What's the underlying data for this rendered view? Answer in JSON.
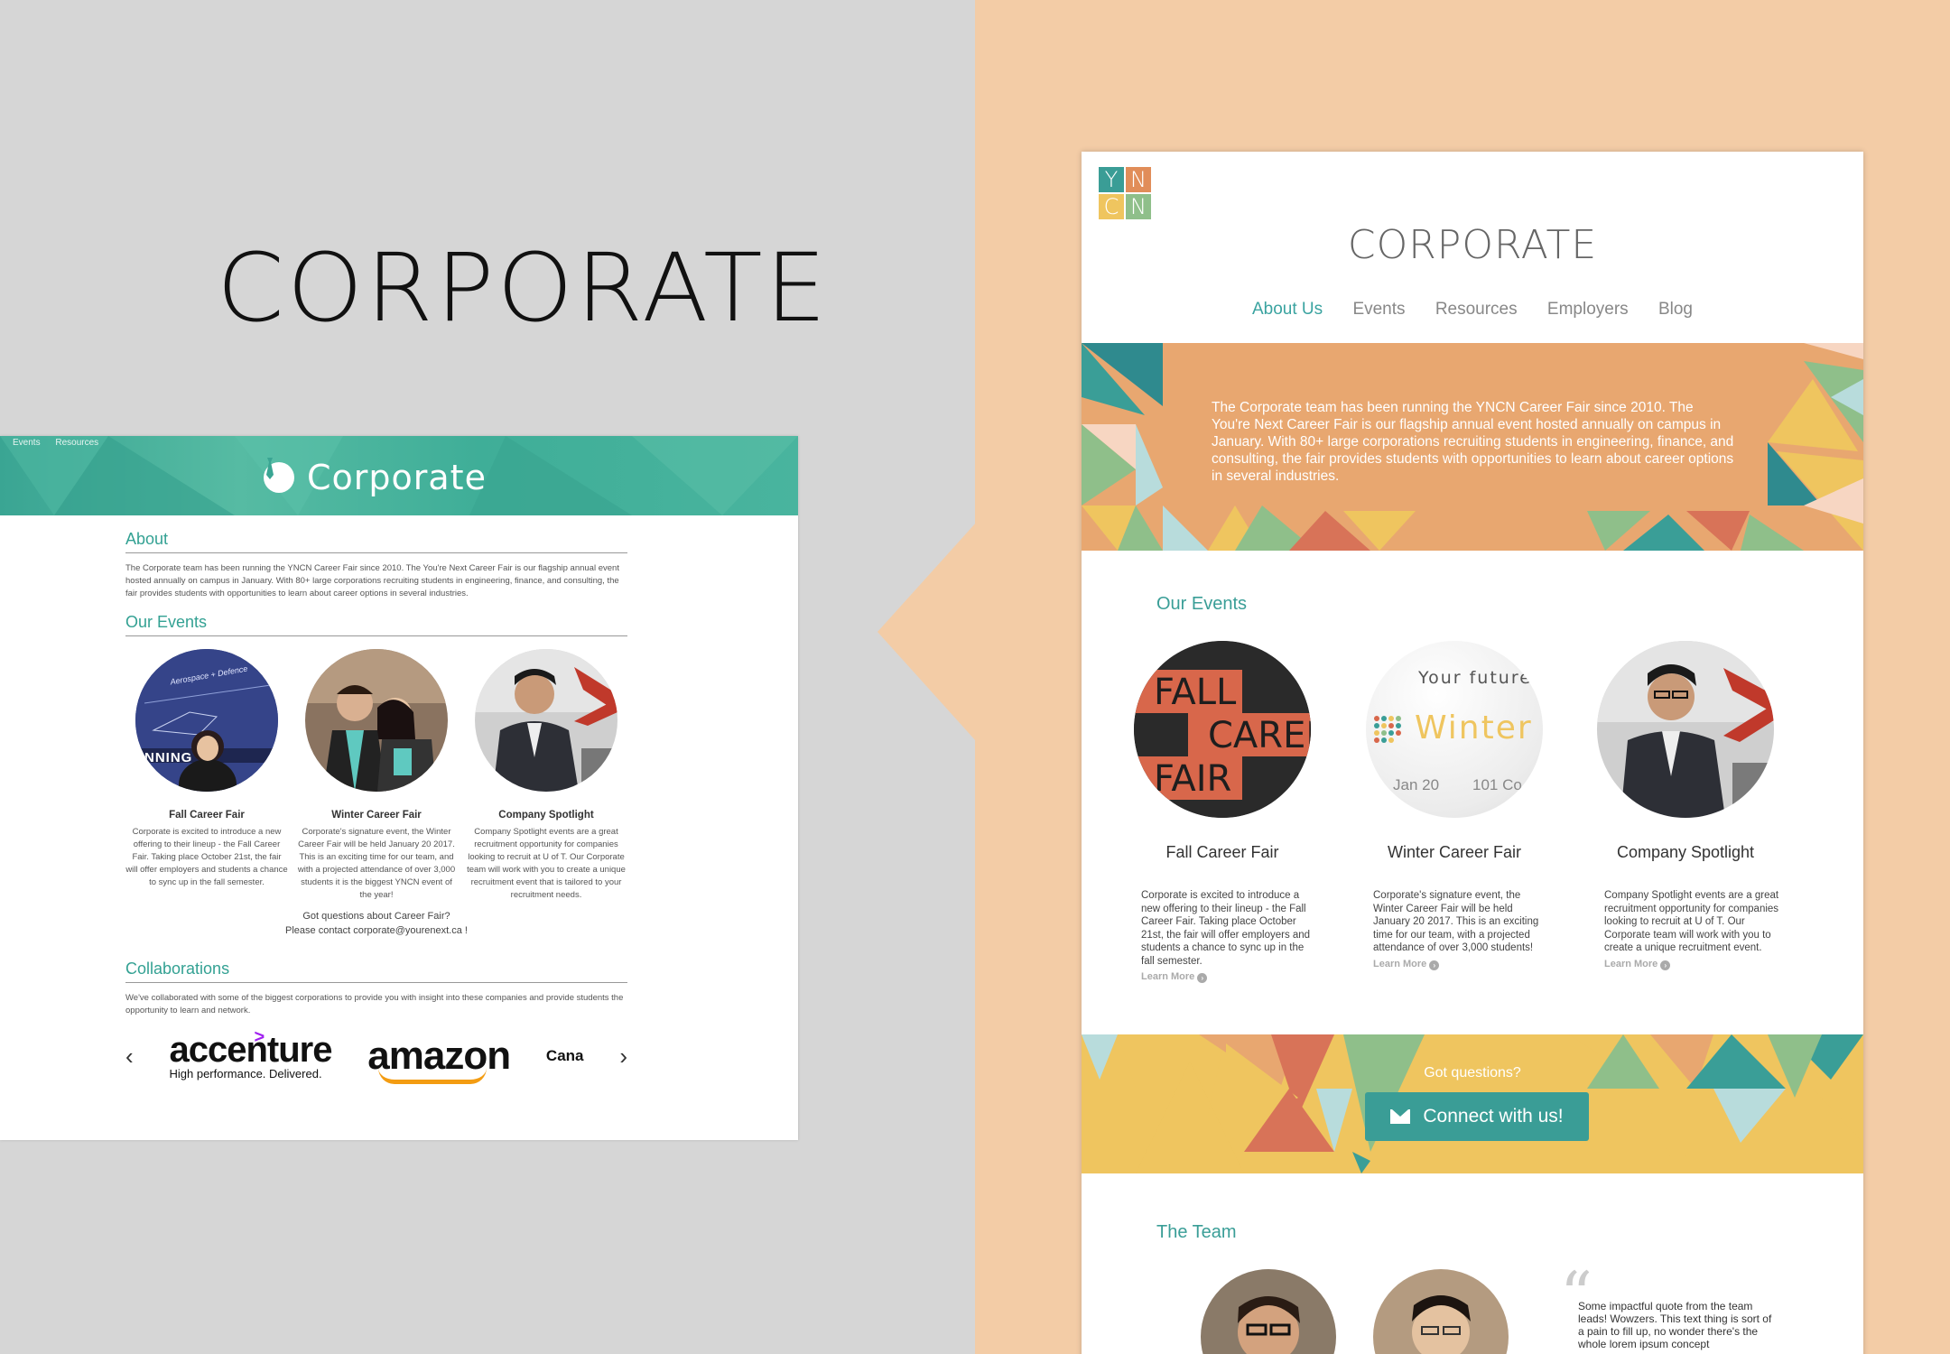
{
  "page_title": "CORPORATE",
  "colors": {
    "teal": "#3aa3a0",
    "orange": "#e8a770",
    "yellow": "#efc55f",
    "peach_bg": "#f3cca6",
    "grey_bg": "#d6d6d6"
  },
  "old_site": {
    "nav": [
      "Events",
      "Resources"
    ],
    "banner_title": "Corporate",
    "about_heading": "About",
    "about_text": "The Corporate team has been running the YNCN Career Fair since 2010. The You're Next Career Fair is our flagship annual event hosted annually on campus in January. With 80+ large corporations recruiting students in engineering, finance, and consulting, the fair provides students with opportunities to learn about career options in several industries.",
    "events_heading": "Our Events",
    "events": [
      {
        "title": "Fall Career Fair",
        "desc": "Corporate is excited to introduce a new offering to their lineup - the Fall Career Fair. Taking place October 21st, the fair will offer employers and students a chance to sync up in the fall semester."
      },
      {
        "title": "Winter Career Fair",
        "desc": "Corporate's signature event, the Winter Career Fair will be held January 20 2017. This is an exciting time for our team, and with a projected attendance of over 3,000 students it is the biggest YNCN event of the year!"
      },
      {
        "title": "Company Spotlight",
        "desc": "Company Spotlight events are a great recruitment opportunity for companies looking to recruit at U of T. Our Corporate team will work with you to create a unique recruitment event that is tailored to your recruitment needs."
      }
    ],
    "question_line1": "Got questions about Career Fair?",
    "question_line2": "Please contact corporate@yourenext.ca !",
    "collab_heading": "Collaborations",
    "collab_text": "We've collaborated with some of the biggest corporations to provide you with insight into these companies and provide students the opportunity to learn and network.",
    "logos": {
      "accenture": "accenture",
      "accenture_tag": "High performance. Delivered.",
      "amazon": "amazon",
      "partial": "Cana"
    },
    "arrow_left": "‹",
    "arrow_right": "›",
    "photo_sign_1": "Aerospace + Defence",
    "photo_sign_2": "NNING"
  },
  "new_site": {
    "logo_letters": [
      "Y",
      "N",
      "C",
      "N"
    ],
    "title": "CORPORATE",
    "nav": [
      "About Us",
      "Events",
      "Resources",
      "Employers",
      "Blog"
    ],
    "hero_text": "The Corporate team has been running the YNCN Career Fair since 2010. The You're Next Career Fair is our flagship annual event hosted annually on campus in January. With 80+ large corporations recruiting students in engineering, finance, and consulting, the fair provides students with opportunities to learn about career options in several industries.",
    "events_heading": "Our Events",
    "events": [
      {
        "title": "Fall Career Fair",
        "desc": "Corporate is excited to introduce a new offering to their lineup - the Fall Career Fair. Taking place October 21st, the fair will offer employers and students a chance to sync up in the fall semester.",
        "learn": "Learn More"
      },
      {
        "title": "Winter Career Fair",
        "desc": "Corporate's signature event, the Winter Career Fair will be held January 20 2017. This is an exciting time for our team, with a projected attendance of over 3,000 students!",
        "learn": "Learn More"
      },
      {
        "title": "Company Spotlight",
        "desc": "Company Spotlight events are a great recruitment opportunity for companies looking to recruit at U of T. Our Corporate team will work with you to create a unique recruitment event.",
        "learn": "Learn More"
      }
    ],
    "fall_poster": [
      "FALL",
      "CAREER",
      "FAIR"
    ],
    "winter_poster": {
      "top": "Your future",
      "main": "Winter C",
      "date": "Jan 20",
      "room": "101 Co"
    },
    "cta_question": "Got questions?",
    "cta_button": "Connect with us!",
    "team_heading": "The Team",
    "quote": "Some impactful quote from the team leads! Wowzers. This text thing is sort of a pain to fill up, no wonder there's the whole lorem ipsum concept"
  }
}
